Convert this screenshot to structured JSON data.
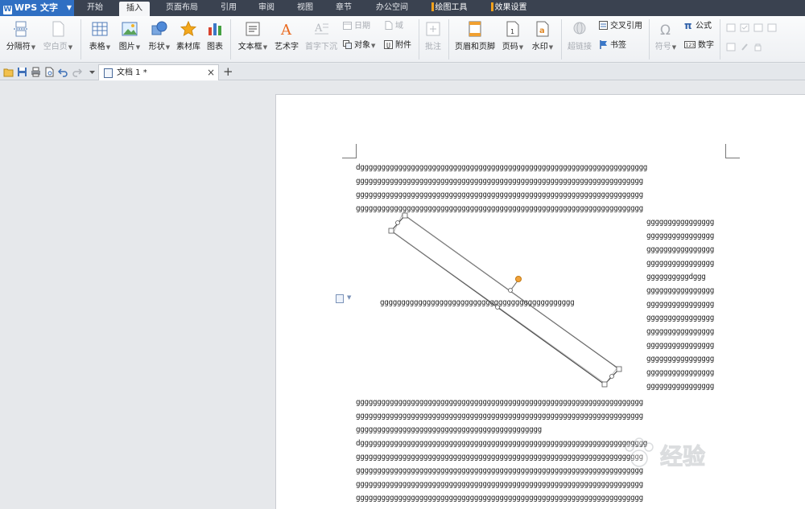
{
  "menubar": {
    "app_name": "WPS 文字",
    "tabs": [
      "开始",
      "插入",
      "页面布局",
      "引用",
      "审阅",
      "视图",
      "章节",
      "办公空间"
    ],
    "active_tab": "插入",
    "tool_tabs": [
      "绘图工具",
      "效果设置"
    ]
  },
  "ribbon": {
    "page_break": "分隔符",
    "blank_page": "空白页",
    "table": "表格",
    "picture": "图片",
    "shape": "形状",
    "material": "素材库",
    "chart": "图表",
    "textbox": "文本框",
    "wordart": "艺术字",
    "dropcap": "首字下沉",
    "date": "日期",
    "field": "域",
    "object": "对象",
    "attachment": "附件",
    "comment": "批注",
    "header_footer": "页眉和页脚",
    "page_number": "页码",
    "watermark": "水印",
    "hyperlink": "超链接",
    "cross_ref": "交叉引用",
    "bookmark": "书签",
    "symbol": "符号",
    "formula": "公式",
    "number": "数字"
  },
  "doc_tab": {
    "title": "文档 1 *",
    "close": "×",
    "new": "+"
  },
  "document": {
    "top_lines": [
      "dgggggggggggggggggggggggggggggggggggggggggggggggggggggggggggggggggggg",
      "gggggggggggggggggggggggggggggggggggggggggggggggggggggggggggggggggggg",
      "gggggggggggggggggggggggggggggggggggggggggggggggggggggggggggggggggggg",
      "gggggggggggggggggggggggggggggggggggggggggggggggggggggggggggggggggggg"
    ],
    "right_column": [
      "gggggggggggggggg",
      "gggggggggggggggg",
      "gggggggggggggggg",
      "gggggggggggggggg",
      "ggggggggggdggg",
      "gggggggggggggggg",
      "gggggggggggggggg",
      "gggggggggggggggg",
      "gggggggggggggggg",
      "gggggggggggggggg",
      "gggggggggggggggg",
      "gggggggggggggggg",
      "gggggggggggggggg"
    ],
    "middle_line": "gggggggggggggggggggggggggggggggggggggggggggggg",
    "bottom_lines": [
      "gggggggggggggggggggggggggggggggggggggggggggggggggggggggggggggggggggg",
      "gggggggggggggggggggggggggggggggggggggggggggggggggggggggggggggggggggg",
      "gggggggggggggggggggggggggggggggggggggggggggg",
      "dgggggggggggggggggggggggggggggggggggggggggggggggggggggggggggggggggggg",
      "gggggggggggggggggggggggggggggggggggggggggggggggggggggggggggggggggggg",
      "gggggggggggggggggggggggggggggggggggggggggggggggggggggggggggggggggggg",
      "gggggggggggggggggggggggggggggggggggggggggggggggggggggggggggggggggggg",
      "gggggggggggggggggggggggggggggggggggggggggggggggggggggggggggggggggggg"
    ]
  },
  "watermark_logo": "经验",
  "colors": {
    "menubar": "#3a4250",
    "app_button": "#2f6fc3",
    "tool_tab_mark": "#f4a21c",
    "rotate_handle": "#f2a23a"
  }
}
